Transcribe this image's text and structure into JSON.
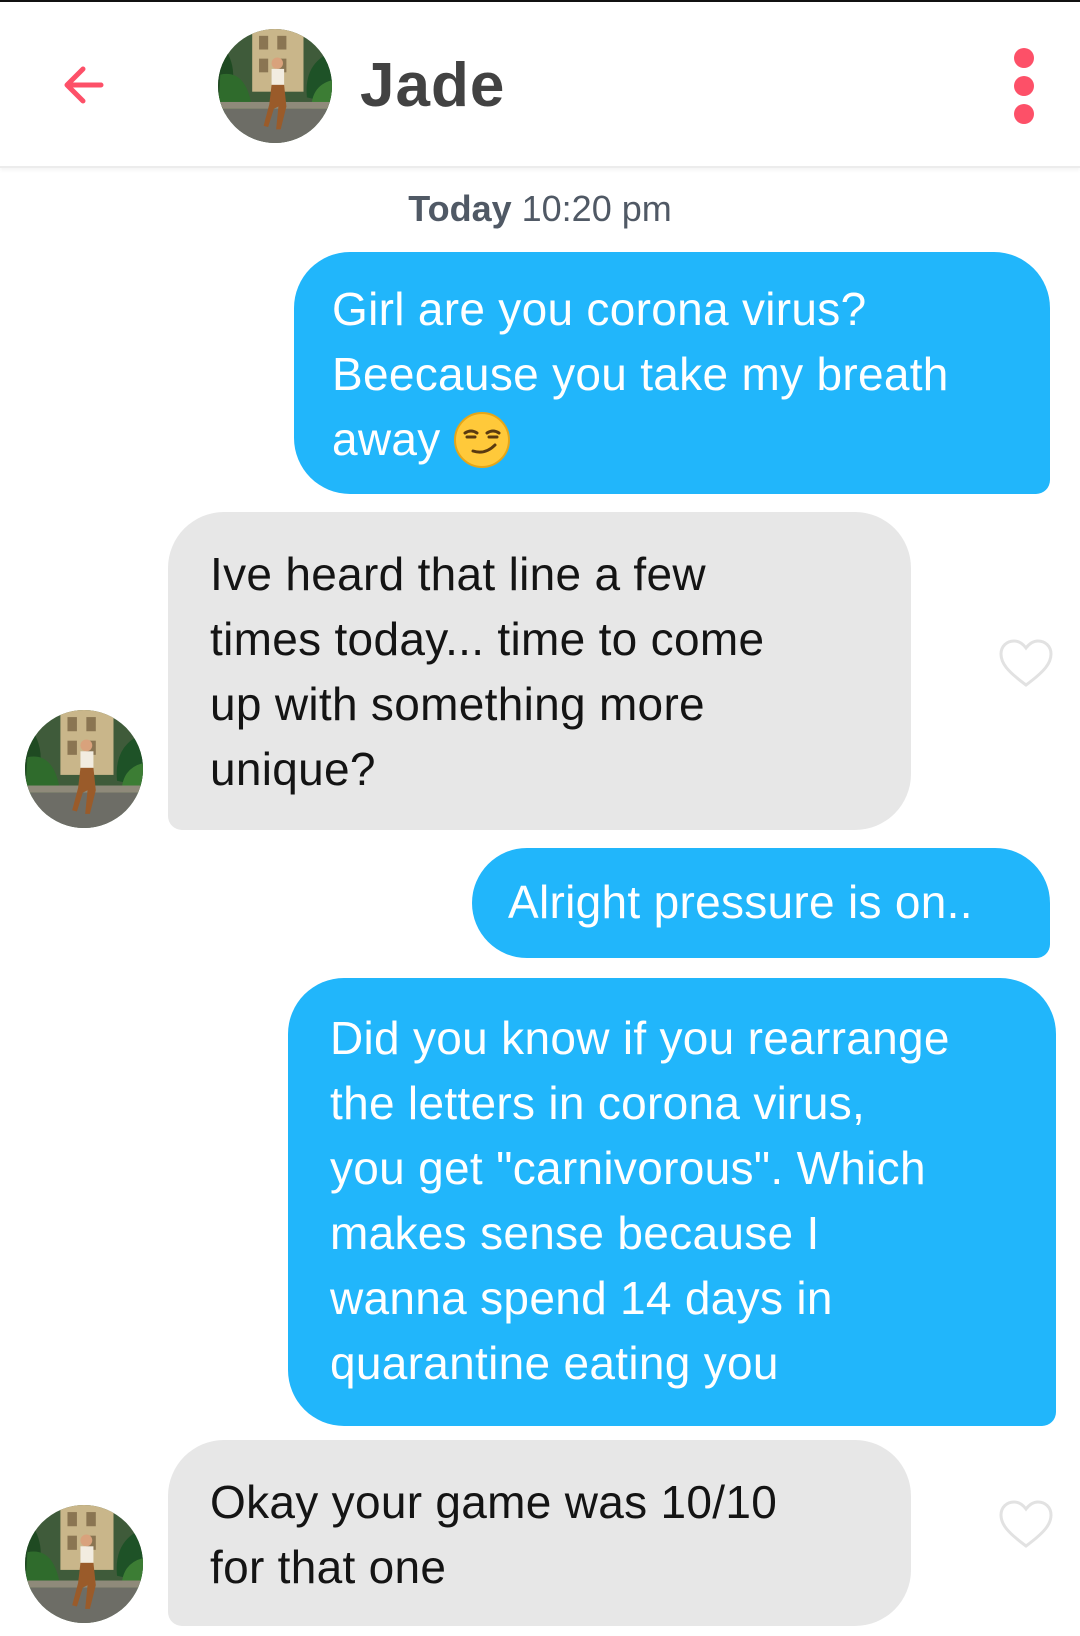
{
  "header": {
    "back_icon": "arrow-left-icon",
    "contact_name": "Jade",
    "menu_icon": "more-vertical-icon",
    "accent_color": "#fd5068"
  },
  "timestamp": {
    "day": "Today",
    "time": "10:20 pm"
  },
  "messages": [
    {
      "sender": "me",
      "lines": [
        "Girl are you corona virus?",
        "Beecause you take my breath",
        "away"
      ],
      "emoji": "smirking-face"
    },
    {
      "sender": "Jade",
      "lines": [
        "Ive heard that line a few",
        "times today... time to come",
        "up with something more",
        "unique?"
      ]
    },
    {
      "sender": "me",
      "lines": [
        "Alright pressure is on.."
      ]
    },
    {
      "sender": "me",
      "lines": [
        "Did you know if you rearrange",
        "the letters in corona virus,",
        "you get \"carnivorous\". Which",
        "makes sense because I",
        "wanna spend 14 days in",
        "quarantine eating you"
      ]
    },
    {
      "sender": "Jade",
      "lines": [
        "Okay your game was 10/10",
        "for that one"
      ]
    }
  ],
  "colors": {
    "outgoing_bubble": "#21b6fb",
    "incoming_bubble": "#e7e7e7"
  }
}
